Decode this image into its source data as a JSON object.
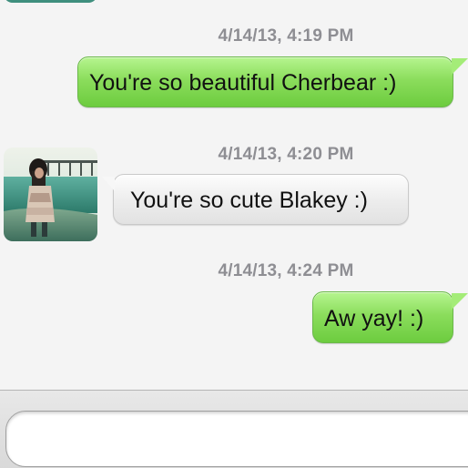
{
  "conversation": {
    "messages": [
      {
        "timestamp": "4/14/13, 4:19 PM",
        "direction": "outgoing",
        "text": "You're so beautiful Cherbear :)"
      },
      {
        "timestamp": "4/14/13, 4:20 PM",
        "direction": "incoming",
        "text": "You're so cute Blakey :)"
      },
      {
        "timestamp": "4/14/13, 4:24 PM",
        "direction": "outgoing",
        "text": "Aw yay! :)"
      }
    ]
  },
  "composer": {
    "value": "",
    "placeholder": ""
  },
  "colors": {
    "outgoing_bubble": "#8bdd5c",
    "incoming_bubble": "#ececec",
    "timestamp_text": "#8e8e93",
    "background": "#f4f4f4"
  }
}
